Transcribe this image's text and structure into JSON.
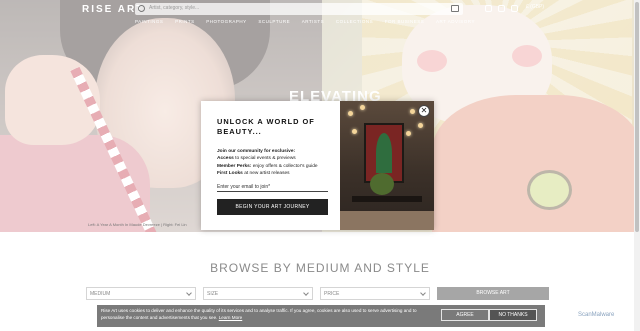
{
  "header": {
    "logo": "RISE ART",
    "search_placeholder": "Artist, category, style...",
    "currency": "£ (GBP)",
    "nav": [
      "PAINTINGS",
      "PRINTS",
      "PHOTOGRAPHY",
      "SCULPTURE",
      "ARTISTS",
      "COLLECTIONS",
      "FOR BUSINESS",
      "ART ADVISORY"
    ]
  },
  "hero": {
    "title": "ELEVATING",
    "credit": "Left: A Year A Month In Maude Devreeze | Right: Fei Lin"
  },
  "modal": {
    "title": "UNLOCK A WORLD OF BEAUTY...",
    "intro": "Join our community for exclusive:",
    "perk1_bold": "Access",
    "perk1_rest": "to special events & previews",
    "perk2_bold": "Member Perks:",
    "perk2_rest": "enjoy offers & collector's guide",
    "perk3_bold": "First Looks",
    "perk3_rest": "at new artist releases",
    "email_placeholder": "Enter your email to join*",
    "cta": "BEGIN YOUR ART JOURNEY",
    "close": "✕"
  },
  "browse": {
    "title": "BROWSE BY MEDIUM AND STYLE",
    "filters": [
      "MEDIUM",
      "SIZE",
      "PRICE"
    ],
    "button": "BROWSE ART"
  },
  "cookie": {
    "text": "Rise Art uses cookies to deliver and enhance the quality of its services and to analyse traffic. If you agree, cookies are also used to serve advertising and to personalise the content and advertisements that you see.",
    "link": "Learn More",
    "agree": "AGREE",
    "disagree": "NO THANKS"
  },
  "watermark": "ScanMalware"
}
